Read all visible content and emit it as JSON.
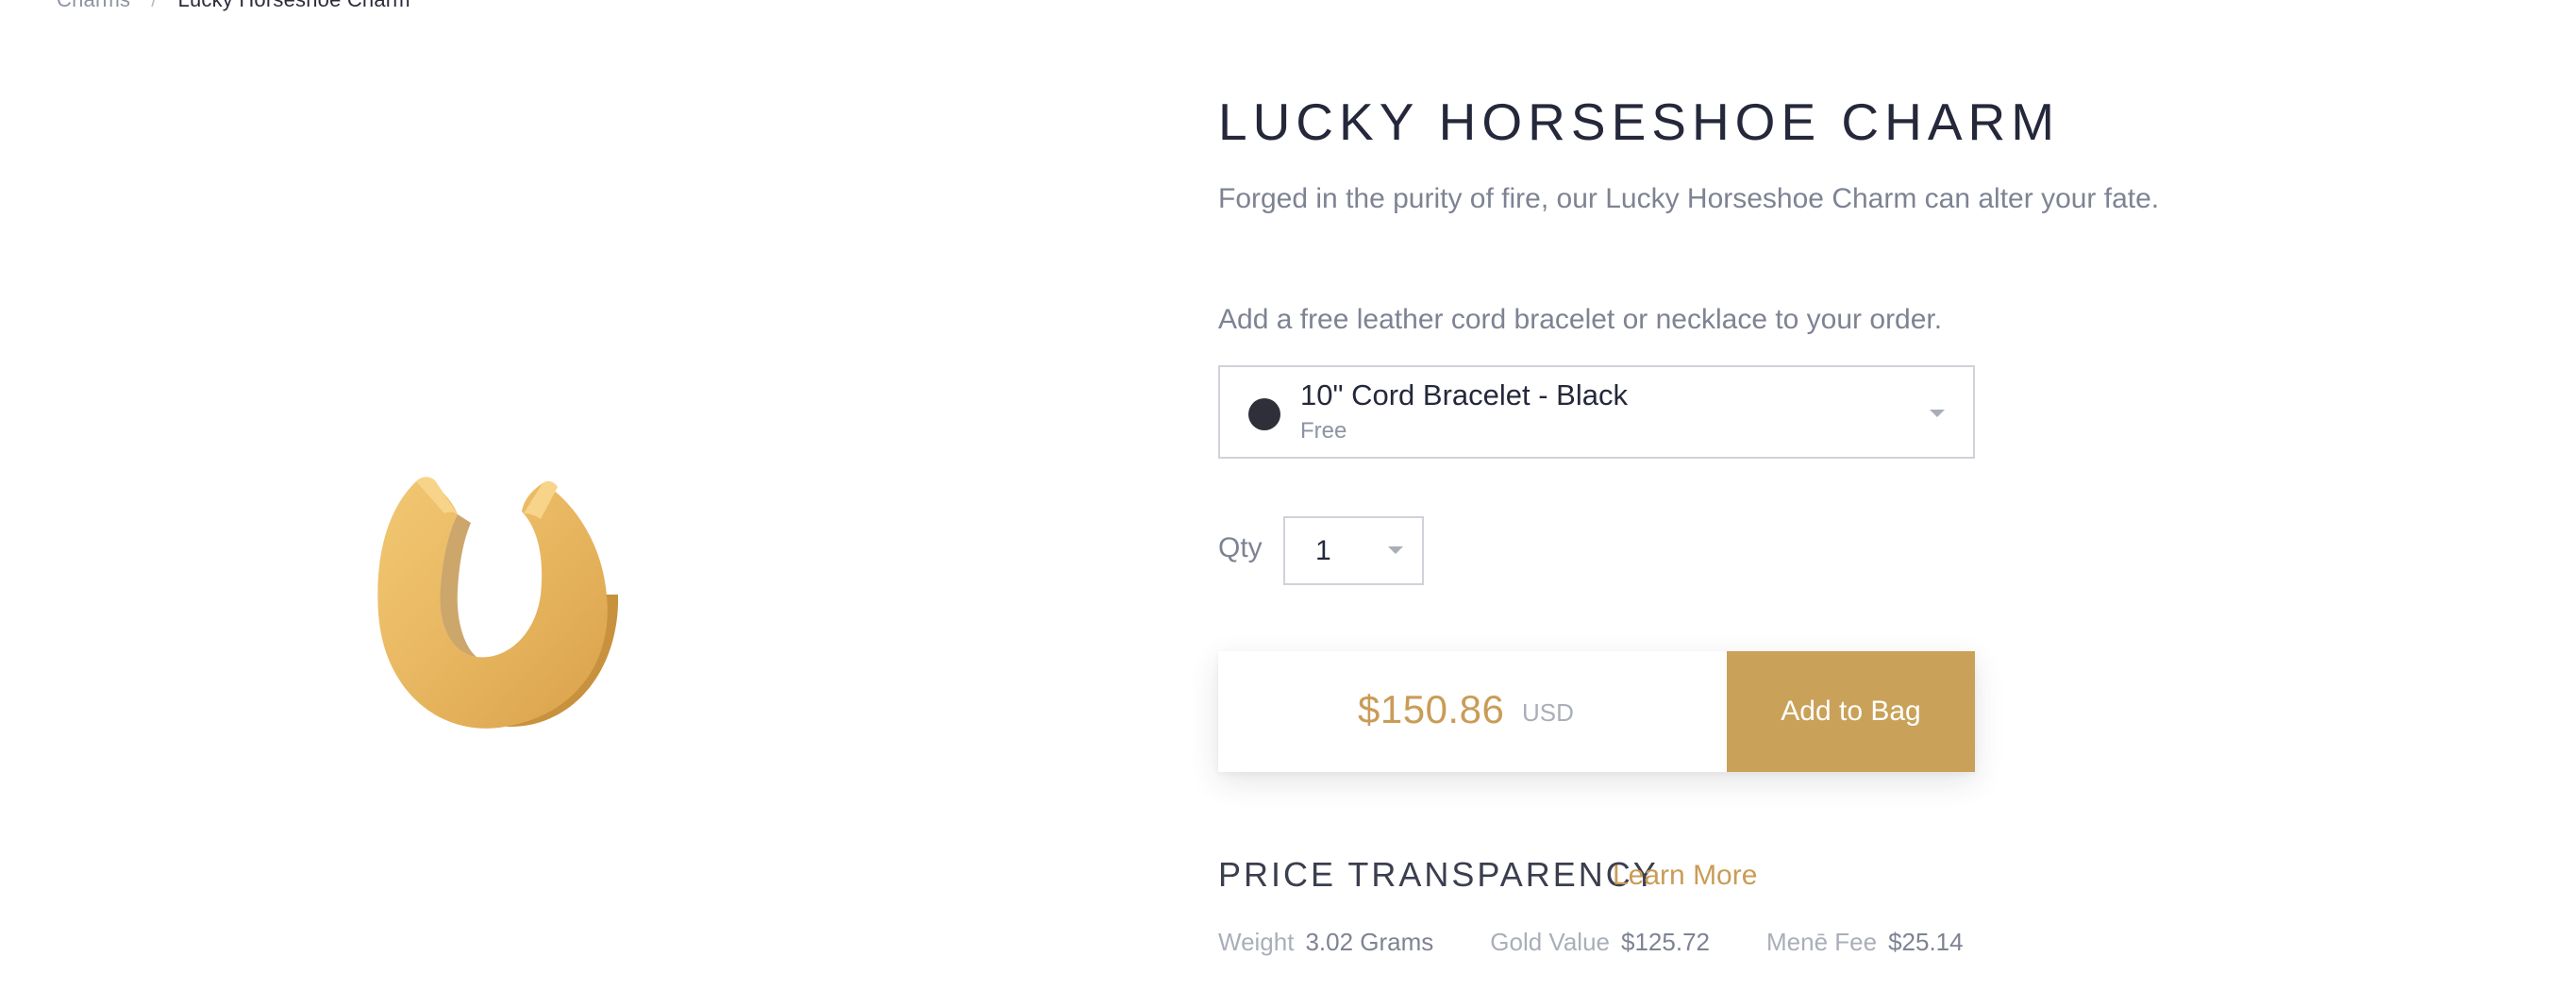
{
  "breadcrumb": {
    "parent": "Charms",
    "separator": "/",
    "current": "Lucky Horseshoe Charm"
  },
  "product": {
    "title": "LUCKY HORSESHOE CHARM",
    "description": "Forged in the purity of fire, our Lucky Horseshoe Charm can alter your fate.",
    "image_icon": "gold-horseshoe-charm"
  },
  "cord": {
    "prompt": "Add a free leather cord bracelet or necklace to your order.",
    "selected_name": "10\" Cord Bracelet - Black",
    "selected_price": "Free",
    "swatch_color": "#2e2f38"
  },
  "quantity": {
    "label": "Qty",
    "value": "1"
  },
  "purchase": {
    "price": "$150.86",
    "currency": "USD",
    "button_label": "Add to Bag",
    "accent_color": "#c9a158"
  },
  "price_transparency": {
    "heading": "PRICE TRANSPARENCY",
    "learn_more": "Learn More",
    "weight_label": "Weight",
    "weight_value": "3.02 Grams",
    "gold_label": "Gold Value",
    "gold_value": "$125.72",
    "fee_label": "Menē Fee",
    "fee_value": "$25.14"
  }
}
